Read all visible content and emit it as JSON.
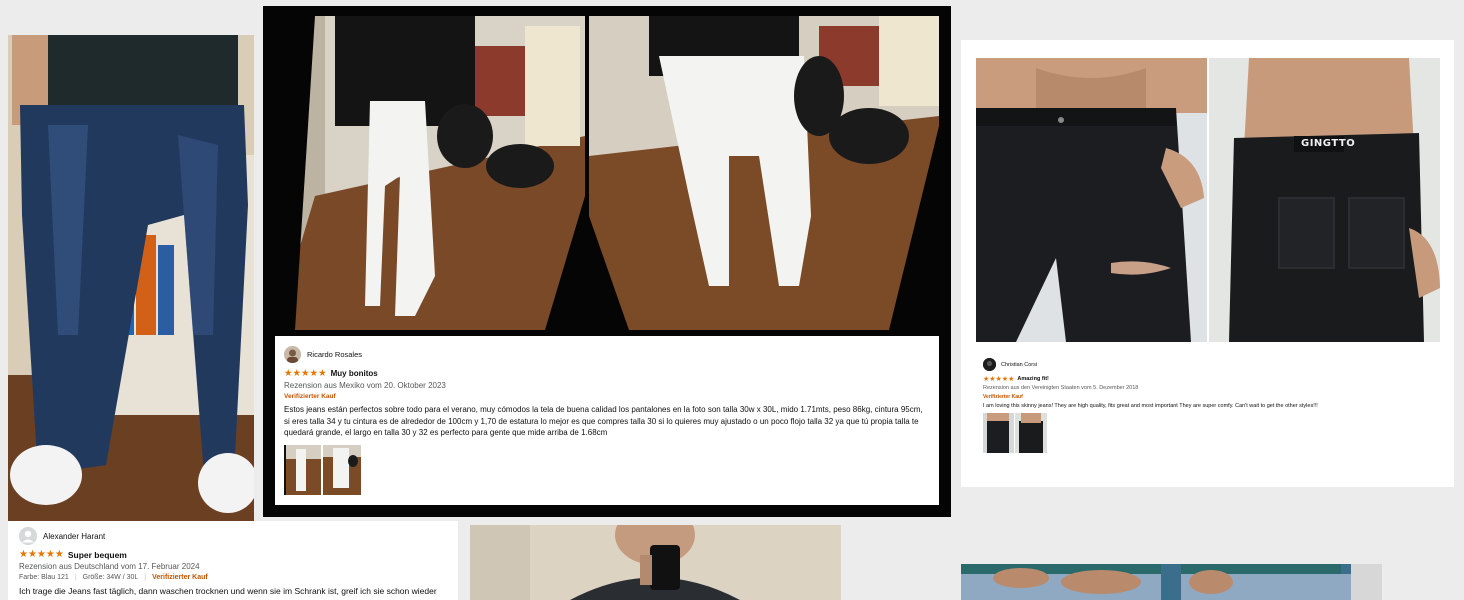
{
  "review_es": {
    "reviewer_name": "Ricardo Rosales",
    "stars": "★★★★★",
    "headline": "Muy bonitos",
    "location_date": "Rezension aus Mexiko vom 20. Oktober 2023",
    "verified": "Verifizierter Kauf",
    "body": "Estos jeans están perfectos sobre todo para el verano, muy cómodos la tela de buena calidad los pantalones en la foto son talla 30w x 30L, mido 1.71mts, peso 86kg, cintura 95cm, si eres talla 34 y tu cintura es de alrededor de 100cm y 1,70 de estatura lo mejor es que compres talla 30 si lo quieres muy ajustado o un poco flojo talla 32 ya que tú propia talla te quedará grande, el largo en talla 30 y 32 es perfecto para gente que mide arriba de 1.68cm"
  },
  "review_en": {
    "reviewer_name": "Christian Corsi",
    "stars": "★★★★★",
    "headline": "Amazing fit!",
    "location_date": "Rezension aus den Vereinigten Staaten vom 5. Dezember 2018",
    "verified": "Verifizierter Kauf",
    "body": "I am loving this skinny jeans! They are high quality, fits great and most important They are super comfy. Can't wait to get the other styles!!!",
    "brand_label": "GINGTTO"
  },
  "review_de": {
    "reviewer_name": "Alexander Harant",
    "stars": "★★★★★",
    "headline": "Super bequem",
    "location_date": "Rezension aus Deutschland vom 17. Februar 2024",
    "color_label": "Farbe: Blau 121",
    "size_label": "Größe: 34W / 30L",
    "verified": "Verifizierter Kauf",
    "body": "Ich trage die Jeans fast täglich, dann waschen trocknen und wenn sie im Schrank ist, greif ich sie schon wieder"
  },
  "colors": {
    "star": "#e77600",
    "verified": "#c45500",
    "background": "#ececec",
    "denim_dark": "#1f3556",
    "denim_mid": "#2c4a78",
    "white_jeans": "#f2f3f1",
    "black_jeans": "#1b1c1e"
  }
}
